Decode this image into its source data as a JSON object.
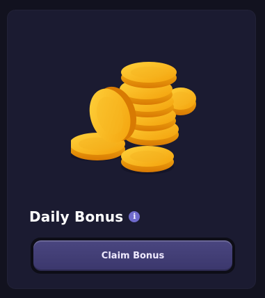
{
  "card": {
    "title": "Daily Bonus",
    "info_icon_glyph": "i",
    "button_label": "Claim Bonus"
  },
  "icons": {
    "coins": "coin-stack-icon",
    "info": "info-icon"
  },
  "colors": {
    "page_background": "#12121f",
    "card_background": "#1b1b31",
    "button_fill": "#3b376c",
    "coin_gold": "#f4a90f",
    "info_icon": "#6f6acb"
  }
}
